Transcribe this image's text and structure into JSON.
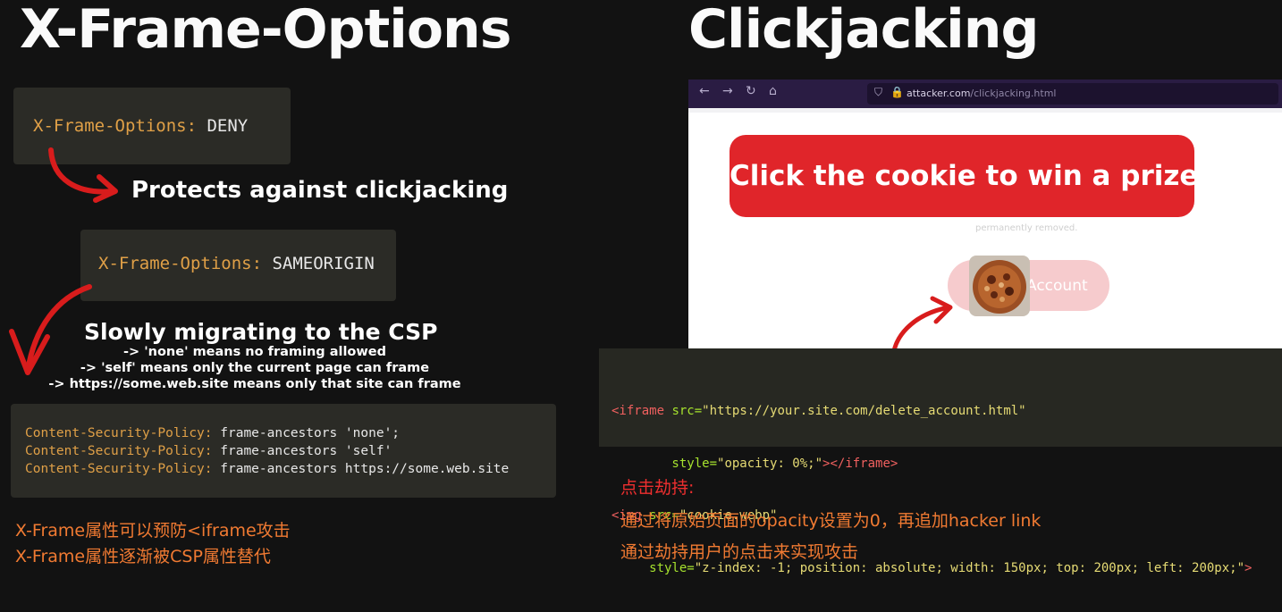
{
  "left": {
    "title": "X-Frame-Options",
    "header1": {
      "key": "X-Frame-Options:",
      "value": "DENY"
    },
    "caption1": "Protects against clickjacking",
    "header2": {
      "key": "X-Frame-Options:",
      "value": "SAMEORIGIN"
    },
    "caption2": "Slowly migrating to the CSP",
    "bullets": [
      "-> 'none' means no framing allowed",
      "-> 'self' means only the current page can frame",
      "-> https://some.web.site means only that site can frame"
    ],
    "csp": [
      {
        "key": "Content-Security-Policy:",
        "value": "frame-ancestors 'none';"
      },
      {
        "key": "Content-Security-Policy:",
        "value": "frame-ancestors 'self'"
      },
      {
        "key": "Content-Security-Policy:",
        "value": "frame-ancestors https://some.web.site"
      }
    ],
    "notes": [
      "X-Frame属性可以预防<iframe攻击",
      "X-Frame属性逐渐被CSP属性替代"
    ]
  },
  "right": {
    "title": "Clickjacking",
    "browser": {
      "url_domain": "attacker.com",
      "url_path": "/clickjacking.html",
      "banner": "Click the cookie to win a prize!",
      "faded_text": "permanently removed.",
      "button_text": "Account"
    },
    "code": {
      "l1_tag": "<iframe",
      "l1_attr": " src=",
      "l1_val": "\"https://your.site.com/delete_account.html\"",
      "l2_attr": "        style=",
      "l2_val": "\"opacity: 0%;\"",
      "l2_tag": "></iframe>",
      "l3_tag": "<img",
      "l3_attr": " src=",
      "l3_val": "\"cookie.webp\"",
      "l4_attr": "     style=",
      "l4_val": "\"z-index: -1; position: absolute; width: 150px; top: 200px; left: 200px;\"",
      "l4_tag": ">"
    },
    "notes": {
      "heading": "点击劫持:",
      "lines": [
        "通过将原始页面的opacity设置为0，再追加hacker link",
        "通过劫持用户的点击来实现攻击"
      ]
    }
  },
  "colors": {
    "accent_red": "#e0252a",
    "note_orange": "#f07a32",
    "key_orange": "#e0a047"
  }
}
